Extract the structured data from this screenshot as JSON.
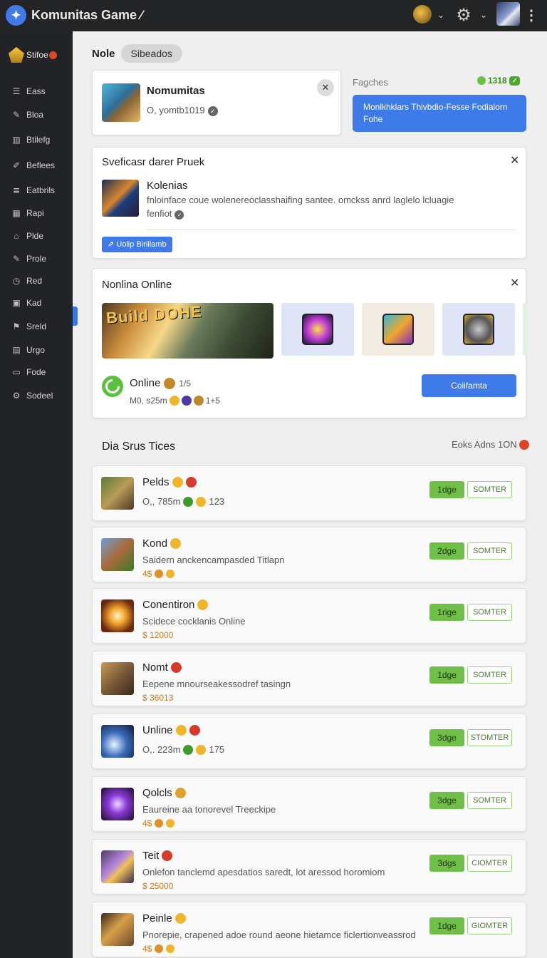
{
  "app": {
    "title": "Komunitas Game ∕"
  },
  "topbar": {
    "gear_icon": "gear-icon",
    "more_icon": "more-vertical-icon"
  },
  "sidebar": {
    "brand": {
      "label": "Stifoe"
    },
    "items": [
      {
        "label": "Eass",
        "icon": "list-icon"
      },
      {
        "label": "Bloa",
        "icon": "pen-icon"
      },
      {
        "label": "Btilefg",
        "icon": "columns-icon"
      },
      {
        "label": "Beflees",
        "icon": "pencil-icon"
      },
      {
        "label": "Eatbrils",
        "icon": "stack-icon"
      },
      {
        "label": "Rapi",
        "icon": "grid-icon"
      },
      {
        "label": "Plde",
        "icon": "tag-icon"
      },
      {
        "label": "Prole",
        "icon": "edit-icon"
      },
      {
        "label": "Red",
        "icon": "clock-icon"
      },
      {
        "label": "Kad",
        "icon": "box-icon"
      },
      {
        "label": "Sreld",
        "icon": "flag-icon"
      },
      {
        "label": "Urgo",
        "icon": "chart-icon"
      },
      {
        "label": "Fode",
        "icon": "doc-icon"
      },
      {
        "label": "Sodeel",
        "icon": "gear-icon"
      }
    ]
  },
  "header": {
    "title": "Nole",
    "tab": "Sibeados"
  },
  "user_card": {
    "name": "Nomumitas",
    "meta": "O,  yomtb1019"
  },
  "fetches": {
    "label": "Fagches",
    "count": "1318",
    "tag": "✓",
    "promo": "Monlkhklars Thivbdio-Fesse Fodiaiorn Fohe"
  },
  "special": {
    "title": "Sveficasr darer Pruek",
    "name": "Kolenias",
    "desc": "fnloinface coue wolenereoclasshaifing santee. omckss anrd laglelo lcluagie fenfiot",
    "button": "Uolip Biriilamb"
  },
  "online": {
    "title": "Nonlina Online",
    "banner_text": "Build DOHE",
    "status": "Online",
    "status_count": "1/5",
    "meta_left": "M0, s25m",
    "meta_right": "1+5",
    "button": "Coiifamta"
  },
  "section": {
    "title": "Dia Srus Tices",
    "right": "Eoks Adns 1ON"
  },
  "rows": [
    {
      "title": "Pelds",
      "sub": "O,, 785m",
      "sub_extra": "123",
      "price": "",
      "badge": "1dge",
      "action": "SOMTER"
    },
    {
      "title": "Kond",
      "sub": "Saidern anckencampasded Titlapn",
      "sub_extra": "",
      "price": "4$",
      "badge": "2dge",
      "action": "SOMTER"
    },
    {
      "title": "Conentiron",
      "sub": "Scidece cocklanis Online",
      "sub_extra": "",
      "price": "$ 12000",
      "badge": "1rige",
      "action": "SOMTER"
    },
    {
      "title": "Nomt",
      "sub": "Eepene mnourseakessodref tasingn",
      "sub_extra": "",
      "price": "$ 36013",
      "badge": "1dge",
      "action": "SOMTER"
    },
    {
      "title": "Unline",
      "sub": "O,. 223m",
      "sub_extra": "175",
      "price": "",
      "badge": "3dge",
      "action": "STOMTER"
    },
    {
      "title": "Qolcls",
      "sub": "Eaureine aa tonorevel Treeckipe",
      "sub_extra": "",
      "price": "4$",
      "badge": "3dge",
      "action": "SOMTER"
    },
    {
      "title": "Teit",
      "sub": "Onlefon tanclemd apesdatios saredt, lot aressod horomiom",
      "sub_extra": "",
      "price": "$ 25000",
      "badge": "3dgs",
      "action": "CIOMTER"
    },
    {
      "title": "Peinle",
      "sub": "Pnorepie, crapened adoe round aeone hietamce ficlertionveassrod",
      "sub_extra": "",
      "price": "4$",
      "badge": "1dge",
      "action": "GIOMTER"
    }
  ]
}
